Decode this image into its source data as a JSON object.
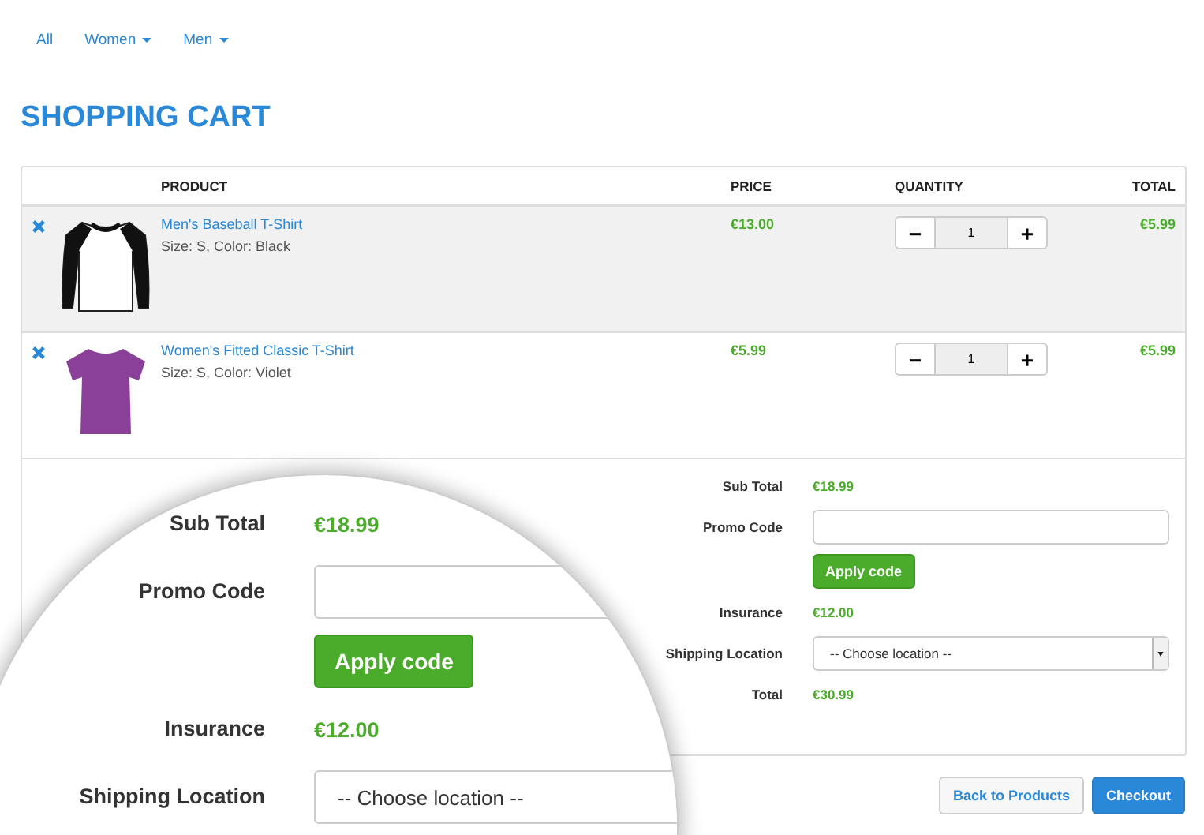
{
  "nav": [
    {
      "label": "All",
      "dropdown": false
    },
    {
      "label": "Women",
      "dropdown": true
    },
    {
      "label": "Men",
      "dropdown": true
    }
  ],
  "title": "SHOPPING CART",
  "table": {
    "columns": [
      "PRODUCT",
      "PRICE",
      "QUANTITY",
      "TOTAL"
    ],
    "rows": [
      {
        "name": "Men's Baseball T-Shirt",
        "details": "Size: S, Color: Black",
        "kind": "raglan",
        "price": "€13.00",
        "minus": "−",
        "quantity": "1",
        "plus": "+",
        "total": "€5.99",
        "highlighted": true
      },
      {
        "name": "Women's Fitted Classic T-Shirt",
        "details": "Size: S, Color: Violet",
        "kind": "tee",
        "price": "€5.99",
        "minus": "−",
        "quantity": "1",
        "plus": "+",
        "total": "€5.99",
        "highlighted": false
      }
    ]
  },
  "summary": [
    {
      "kind": "value",
      "label": "Sub Total",
      "value": "€18.99"
    },
    {
      "kind": "input",
      "label": "Promo Code"
    },
    {
      "kind": "button",
      "label": "Apply code"
    },
    {
      "kind": "value",
      "label": "Insurance",
      "value": "€12.00"
    },
    {
      "kind": "select",
      "label": "Shipping Location",
      "value": "-- Choose location --"
    },
    {
      "kind": "value",
      "label": "Total",
      "value": "€30.99"
    }
  ],
  "magnifier": [
    {
      "kind": "value",
      "label": "Sub Total",
      "value": "€18.99"
    },
    {
      "kind": "input",
      "label": "Promo Code"
    },
    {
      "kind": "button",
      "label": "Apply code"
    },
    {
      "kind": "value",
      "label": "Insurance",
      "value": "€12.00"
    },
    {
      "kind": "select",
      "label": "Shipping Location",
      "value": "-- Choose location --"
    }
  ],
  "buttons": [
    {
      "label": "Back to Products",
      "primary": false
    },
    {
      "label": "Checkout",
      "primary": true
    }
  ]
}
